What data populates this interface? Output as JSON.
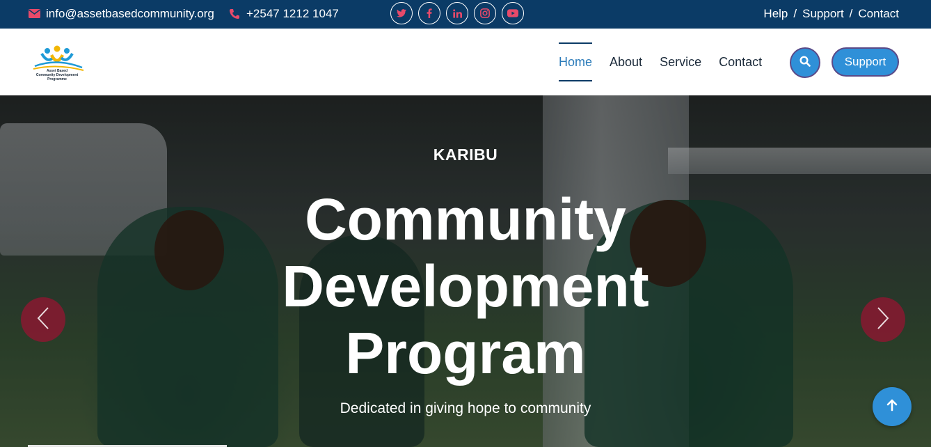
{
  "topbar": {
    "email": "info@assetbasedcommunity.org",
    "phone": "+2547 1212 1047",
    "social": [
      "twitter-icon",
      "facebook-icon",
      "linkedin-icon",
      "instagram-icon",
      "youtube-icon"
    ],
    "links": [
      "Help",
      "Support",
      "Contact"
    ],
    "separator": "/",
    "bg_color": "#0b3b66",
    "icon_color": "#e84a6a"
  },
  "logo": {
    "line1": "Asset Based",
    "line2": "Community Development",
    "line3": "Programme"
  },
  "nav": {
    "items": [
      "Home",
      "About",
      "Service",
      "Contact"
    ],
    "active": "Home",
    "support_label": "Support",
    "accent_color": "#2f90d8"
  },
  "hero": {
    "kicker": "KARIBU",
    "title_lines": [
      "Community",
      "Development",
      "Program"
    ],
    "subtitle": "Dedicated in giving hope to community",
    "arrow_color": "#96142f"
  }
}
